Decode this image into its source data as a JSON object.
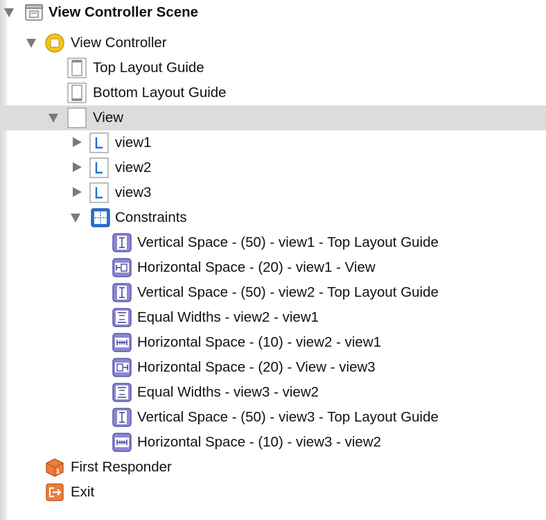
{
  "tree": {
    "scene": {
      "label": "View Controller Scene",
      "icon": "scene-icon"
    },
    "view_controller": {
      "label": "View Controller",
      "icon": "view-controller-icon"
    },
    "top_layout_guide": {
      "label": "Top Layout Guide",
      "icon": "top-layout-guide-icon"
    },
    "bottom_layout_guide": {
      "label": "Bottom Layout Guide",
      "icon": "bottom-layout-guide-icon"
    },
    "view": {
      "label": "View",
      "icon": "view-icon"
    },
    "subviews": [
      {
        "label": "view1",
        "icon": "label-icon"
      },
      {
        "label": "view2",
        "icon": "label-icon"
      },
      {
        "label": "view3",
        "icon": "label-icon"
      }
    ],
    "constraints": {
      "label": "Constraints",
      "icon": "constraints-icon"
    },
    "constraint_items": [
      {
        "label": "Vertical Space - (50) - view1 - Top Layout Guide",
        "icon": "vertical-space-icon"
      },
      {
        "label": "Horizontal Space - (20) - view1 - View",
        "icon": "horizontal-space-leading-icon"
      },
      {
        "label": "Vertical Space - (50) - view2 - Top Layout Guide",
        "icon": "vertical-space-icon"
      },
      {
        "label": "Equal Widths - view2 - view1",
        "icon": "equal-widths-icon"
      },
      {
        "label": "Horizontal Space - (10) - view2 - view1",
        "icon": "horizontal-space-icon"
      },
      {
        "label": "Horizontal Space - (20) - View - view3",
        "icon": "horizontal-space-trailing-icon"
      },
      {
        "label": "Equal Widths - view3 - view2",
        "icon": "equal-widths-icon"
      },
      {
        "label": "Vertical Space - (50) - view3 - Top Layout Guide",
        "icon": "vertical-space-icon"
      },
      {
        "label": "Horizontal Space - (10) - view3 - view2",
        "icon": "horizontal-space-icon"
      }
    ],
    "first_responder": {
      "label": "First Responder",
      "icon": "first-responder-icon"
    },
    "exit": {
      "label": "Exit",
      "icon": "exit-icon"
    }
  },
  "colors": {
    "selection": "#dcdcdc",
    "disclosure": "#7a7a7a",
    "constraint_icon": "#8b86d6",
    "label_icon_blue": "#1f6fd6",
    "view_controller_yellow": "#f5c518",
    "exit_orange": "#ef7d3a"
  }
}
